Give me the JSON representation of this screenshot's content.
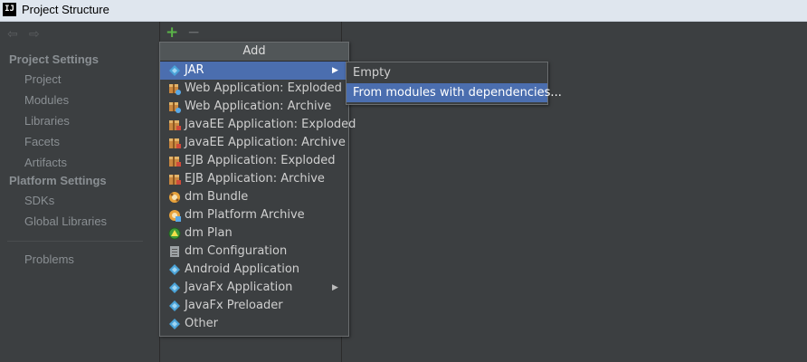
{
  "window": {
    "title": "Project Structure",
    "logo_text": "IJ"
  },
  "nav": {
    "back_arrow": "⇦",
    "forward_arrow": "⇨"
  },
  "sidebar": {
    "project_settings": "Project Settings",
    "project_items": [
      "Project",
      "Modules",
      "Libraries",
      "Facets",
      "Artifacts"
    ],
    "platform_settings": "Platform Settings",
    "platform_items": [
      "SDKs",
      "Global Libraries"
    ],
    "problems": "Problems"
  },
  "toolbar": {
    "add_icon": "+",
    "remove_icon": "−"
  },
  "add_menu": {
    "header": "Add",
    "items": [
      {
        "label": "JAR",
        "icon": "diamond-icon",
        "submenu": true,
        "selected": true
      },
      {
        "label": "Web Application: Exploded",
        "icon": "web-app-icon"
      },
      {
        "label": "Web Application: Archive",
        "icon": "web-app-icon"
      },
      {
        "label": "JavaEE Application: Exploded",
        "icon": "javaee-icon"
      },
      {
        "label": "JavaEE Application: Archive",
        "icon": "javaee-icon"
      },
      {
        "label": "EJB Application: Exploded",
        "icon": "javaee-icon"
      },
      {
        "label": "EJB Application: Archive",
        "icon": "javaee-icon"
      },
      {
        "label": "dm Bundle",
        "icon": "bundle-icon"
      },
      {
        "label": "dm Platform Archive",
        "icon": "bundle-icon"
      },
      {
        "label": "dm Plan",
        "icon": "plan-icon"
      },
      {
        "label": "dm Configuration",
        "icon": "config-icon"
      },
      {
        "label": "Android Application",
        "icon": "diamond-icon"
      },
      {
        "label": "JavaFx Application",
        "icon": "diamond-icon",
        "submenu": true
      },
      {
        "label": "JavaFx Preloader",
        "icon": "diamond-icon"
      },
      {
        "label": "Other",
        "icon": "diamond-icon"
      }
    ]
  },
  "jar_submenu": {
    "items": [
      {
        "label": "Empty"
      },
      {
        "label": "From modules with dependencies...",
        "selected": true
      }
    ]
  },
  "colors": {
    "background": "#3c3f41",
    "selection": "#4b6eaf",
    "titlebar": "#dfe6ee"
  }
}
